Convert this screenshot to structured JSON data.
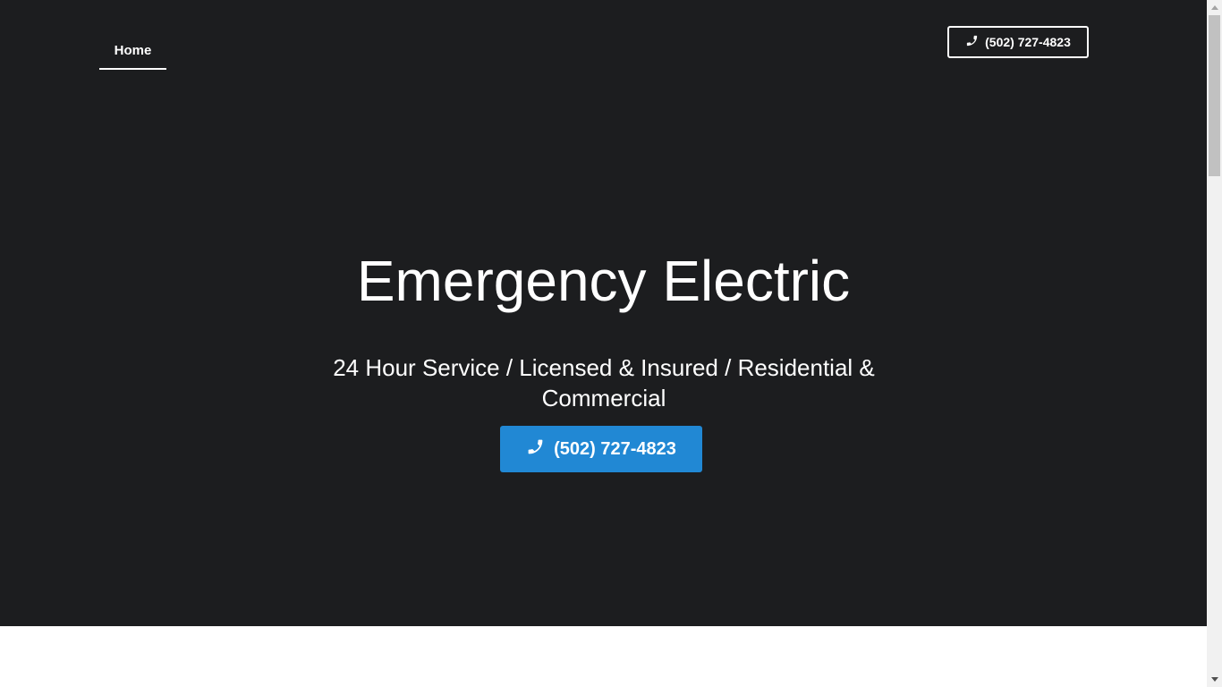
{
  "nav": {
    "items": [
      {
        "label": "Home",
        "active": true
      }
    ]
  },
  "header": {
    "phone_label": "(502) 727-4823",
    "phone_icon": "phone-icon"
  },
  "hero": {
    "title": "Emergency Electric",
    "subtitle": "24 Hour Service / Licensed & Insured / Residential & Commercial",
    "cta_label": "(502) 727-4823",
    "cta_icon": "phone-icon"
  },
  "colors": {
    "hero_background": "#1c1d1f",
    "accent": "#2188d4",
    "text": "#ffffff"
  }
}
